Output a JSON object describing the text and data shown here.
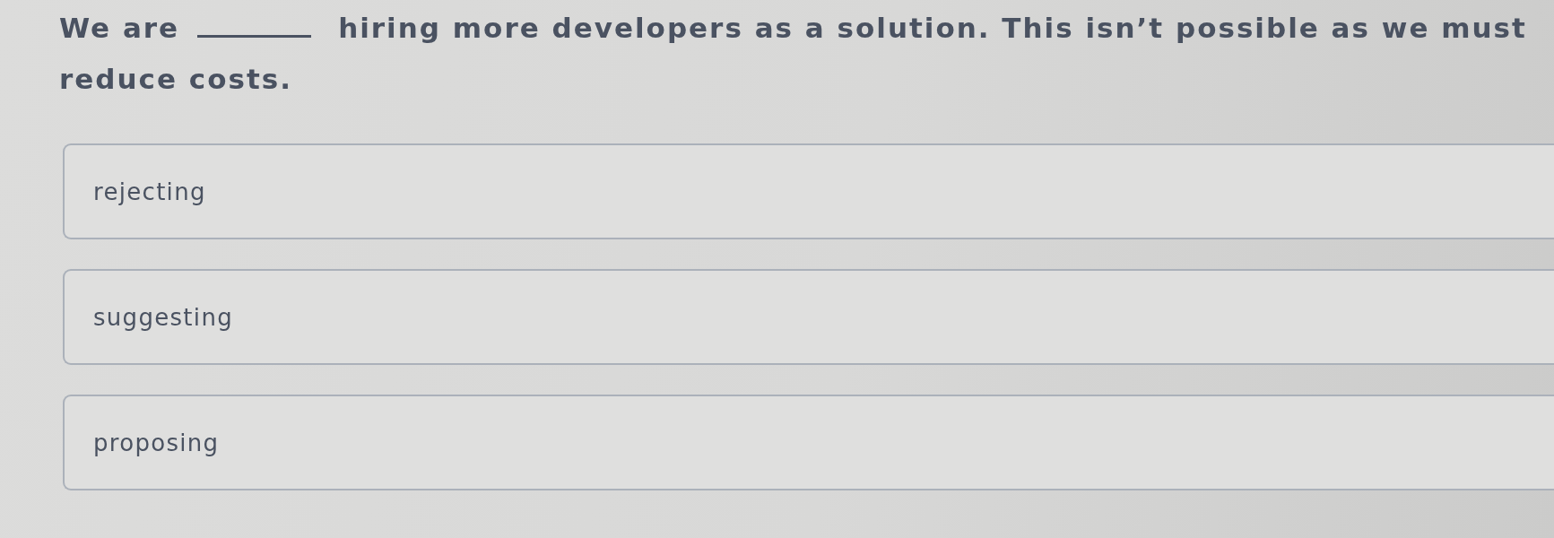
{
  "question": {
    "lines": [
      [
        {
          "kind": "text",
          "text": "We are"
        },
        {
          "kind": "blank"
        },
        {
          "kind": "text",
          "text": "hiring more developers as a solution. This isn’t possible as we must"
        }
      ],
      [
        {
          "kind": "text",
          "text": "reduce costs."
        }
      ]
    ]
  },
  "options": [
    {
      "label": "rejecting",
      "selected": false
    },
    {
      "label": "suggesting",
      "selected": false
    },
    {
      "label": "proposing",
      "selected": false
    }
  ]
}
